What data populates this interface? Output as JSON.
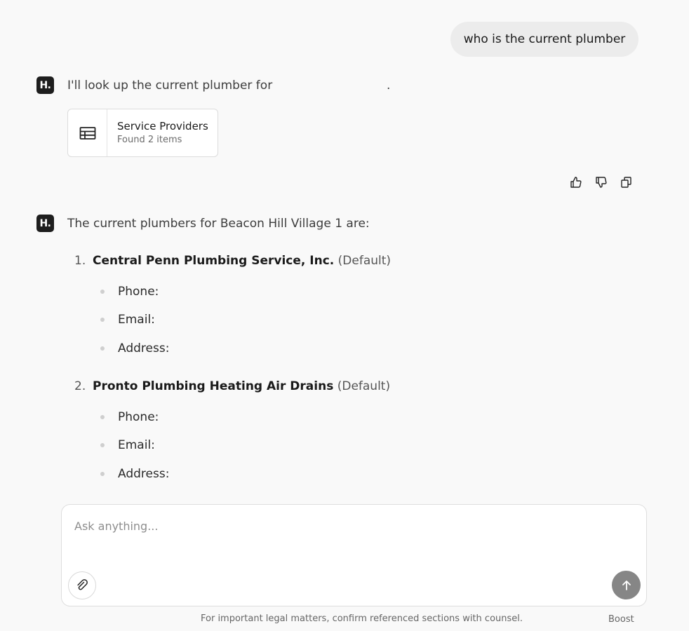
{
  "user_message": "who is the current plumber",
  "assistant": {
    "avatar_label": "H.",
    "message1_text": "I'll look up the current plumber for",
    "message1_trailing": ".",
    "tool_card": {
      "icon": "table-icon",
      "title": "Service Providers",
      "subtitle": "Found 2 items"
    },
    "feedback": {
      "thumbs_up_icon": "thumbs-up-icon",
      "thumbs_down_icon": "thumbs-down-icon",
      "copy_icon": "copy-icon"
    },
    "message2_text": "The current plumbers for Beacon Hill Village 1 are:",
    "providers": [
      {
        "number": "1.",
        "name": "Central Penn Plumbing Service, Inc.",
        "tag": "(Default)",
        "fields": [
          "Phone:",
          "Email:",
          "Address:"
        ]
      },
      {
        "number": "2.",
        "name": "Pronto Plumbing Heating Air Drains",
        "tag": "(Default)",
        "fields": [
          "Phone:",
          "Email:",
          "Address:"
        ]
      }
    ]
  },
  "composer": {
    "placeholder": "Ask anything...",
    "attach_icon": "paperclip-icon",
    "send_icon": "arrow-up-icon"
  },
  "footer": {
    "disclaimer": "For important legal matters, confirm referenced sections with counsel.",
    "boost_label": "Boost"
  },
  "colors": {
    "background": "#f9f9f9",
    "user_bubble": "#ececec",
    "avatar_bg": "#1e1e1e",
    "send_button": "#868686"
  }
}
